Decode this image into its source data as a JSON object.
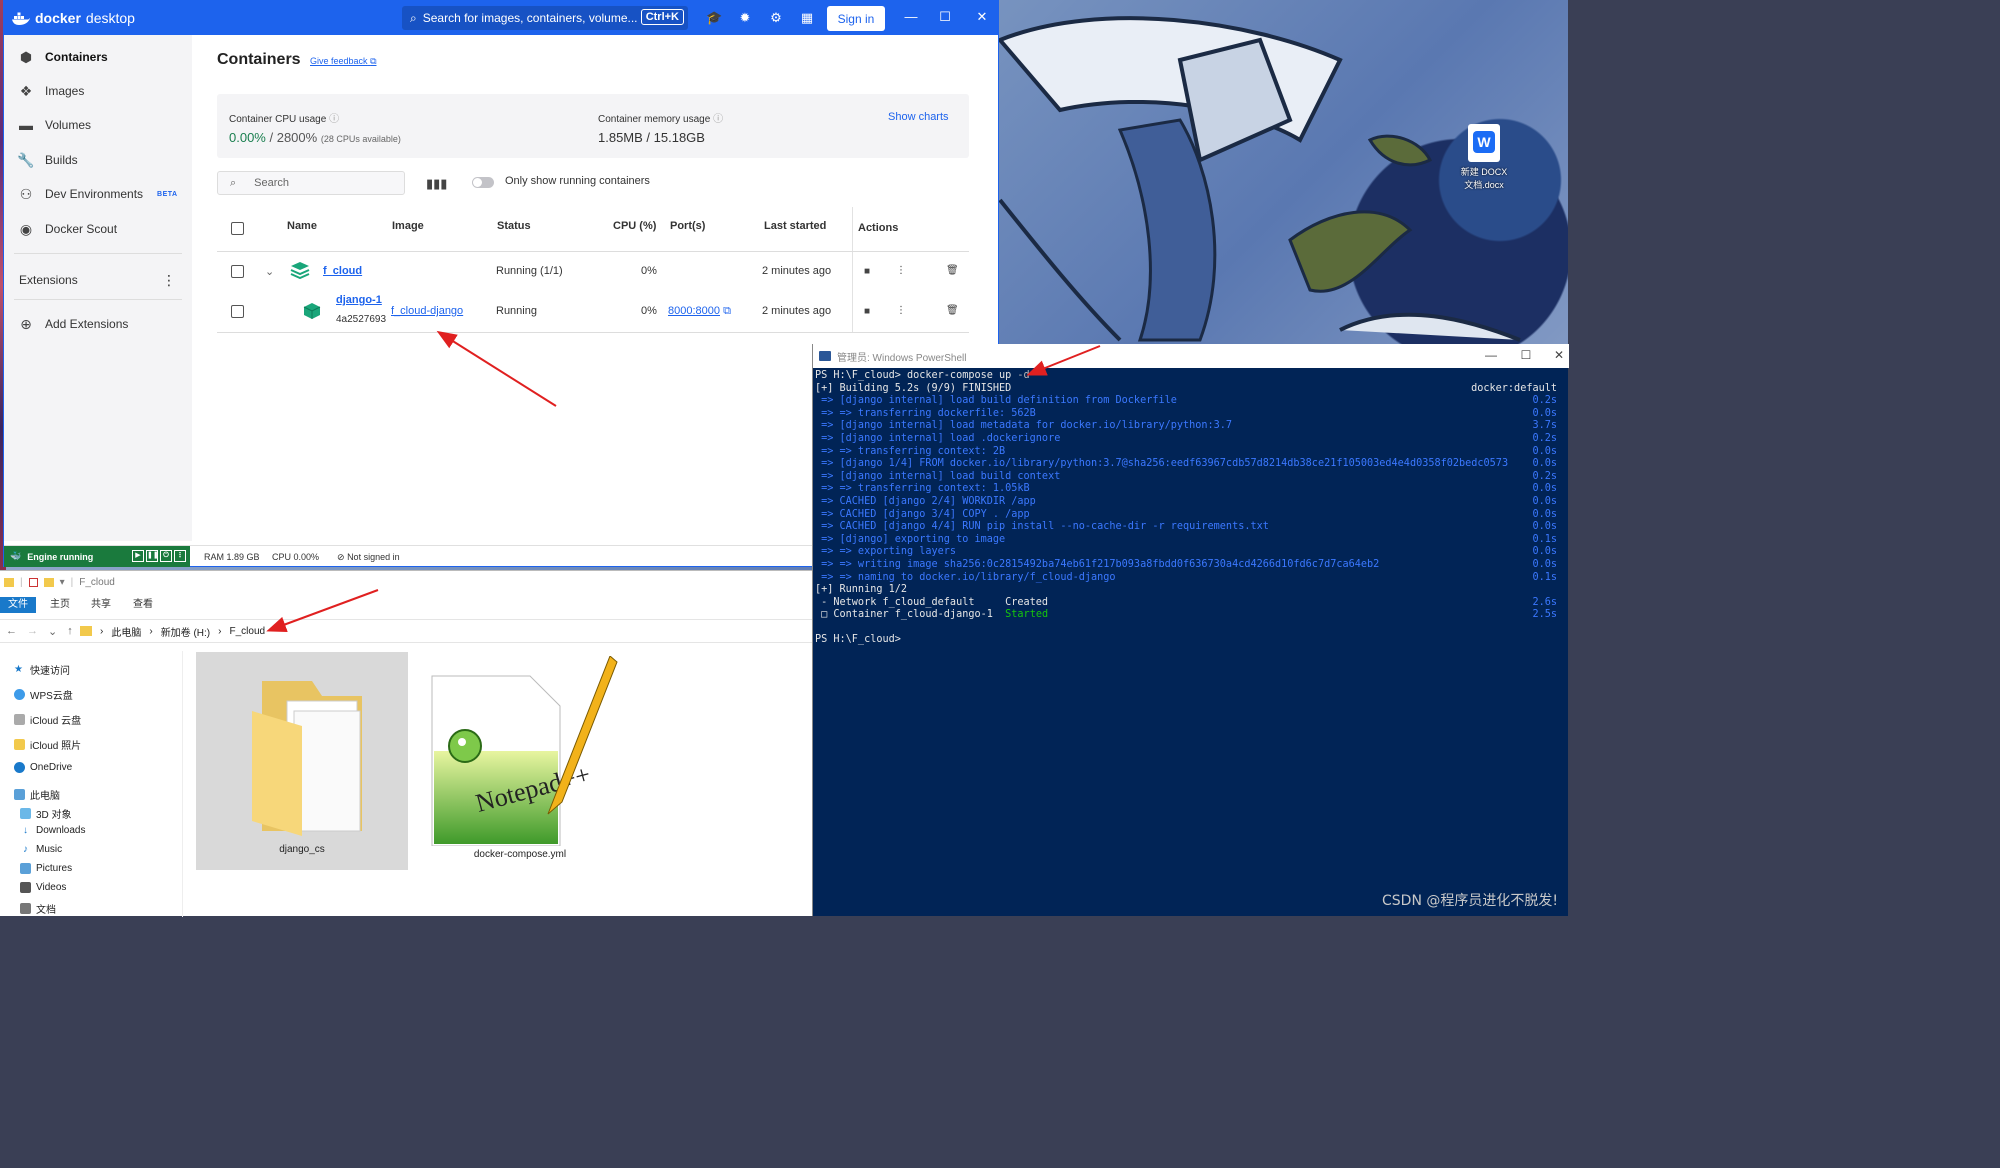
{
  "docker": {
    "app_name_bold": "docker",
    "app_name_rest": "desktop",
    "search_placeholder": "Search for images, containers, volume...",
    "search_shortcut": "Ctrl+K",
    "sign_in": "Sign in",
    "sidebar": {
      "items": [
        {
          "label": "Containers",
          "icon": "container-icon"
        },
        {
          "label": "Images",
          "icon": "images-icon"
        },
        {
          "label": "Volumes",
          "icon": "volumes-icon"
        },
        {
          "label": "Builds",
          "icon": "builds-icon"
        },
        {
          "label": "Dev Environments",
          "icon": "dev-env-icon",
          "badge": "BETA"
        },
        {
          "label": "Docker Scout",
          "icon": "scout-icon"
        }
      ],
      "extensions_label": "Extensions",
      "add_extensions": "Add Extensions"
    },
    "main": {
      "title": "Containers",
      "feedback": "Give feedback",
      "cpu_label": "Container CPU usage",
      "cpu_value": "0.00%",
      "cpu_value_rest": " / 2800%",
      "cpu_sub": "(28 CPUs available)",
      "mem_label": "Container memory usage",
      "mem_value": "1.85MB / 15.18GB",
      "show_charts": "Show charts",
      "search_placeholder": "Search",
      "toggle_label": "Only show running containers",
      "columns": [
        "Name",
        "Image",
        "Status",
        "CPU (%)",
        "Port(s)",
        "Last started",
        "Actions"
      ],
      "rows": [
        {
          "name": "f_cloud",
          "image": "",
          "status": "Running (1/1)",
          "cpu": "0%",
          "port": "",
          "last_started": "2 minutes ago"
        },
        {
          "name": "django-1",
          "id": "4a2527693",
          "image": "f_cloud-django",
          "status": "Running",
          "cpu": "0%",
          "port": "8000:8000",
          "last_started": "2 minutes ago"
        }
      ]
    },
    "status": {
      "engine": "Engine running",
      "ram": "RAM 1.89 GB",
      "cpu": "CPU 0.00%",
      "signed": "Not signed in"
    },
    "colors": {
      "brand": "#1d63ed",
      "running": "#1a7a3d"
    }
  },
  "explorer": {
    "title": "F_cloud",
    "tabs": [
      "文件",
      "主页",
      "共享",
      "查看"
    ],
    "path": [
      "此电脑",
      "新加卷 (H:)",
      "F_cloud"
    ],
    "tree": [
      "快速访问",
      "WPS云盘",
      "iCloud 云盘",
      "iCloud 照片",
      "OneDrive",
      "此电脑",
      "3D 对象",
      "Downloads",
      "Music",
      "Pictures",
      "Videos",
      "文档"
    ],
    "files": [
      {
        "name": "django_cs",
        "type": "folder"
      },
      {
        "name": "docker-compose.yml",
        "type": "notepad++-file"
      }
    ]
  },
  "powershell": {
    "title": "管理员: Windows PowerShell",
    "lines": [
      {
        "text": "PS H:\\F_cloud> docker-compose up ",
        "extra": "-d",
        "style": "plain",
        "right": ""
      },
      {
        "text": "[+] Building 5.2s (9/9) FINISHED",
        "style": "plain",
        "right": "docker:default"
      },
      {
        "text": " => [django internal] load build definition from Dockerfile",
        "style": "blue",
        "right": "0.2s"
      },
      {
        "text": " => => transferring dockerfile: 562B",
        "style": "blue",
        "right": "0.0s"
      },
      {
        "text": " => [django internal] load metadata for docker.io/library/python:3.7",
        "style": "blue",
        "right": "3.7s"
      },
      {
        "text": " => [django internal] load .dockerignore",
        "style": "blue",
        "right": "0.2s"
      },
      {
        "text": " => => transferring context: 2B",
        "style": "blue",
        "right": "0.0s"
      },
      {
        "text": " => [django 1/4] FROM docker.io/library/python:3.7@sha256:eedf63967cdb57d8214db38ce21f105003ed4e4d0358f02bedc0573",
        "style": "blue",
        "right": "0.0s"
      },
      {
        "text": " => [django internal] load build context",
        "style": "blue",
        "right": "0.2s"
      },
      {
        "text": " => => transferring context: 1.05kB",
        "style": "blue",
        "right": "0.0s"
      },
      {
        "text": " => CACHED [django 2/4] WORKDIR /app",
        "style": "blue",
        "right": "0.0s"
      },
      {
        "text": " => CACHED [django 3/4] COPY . /app",
        "style": "blue",
        "right": "0.0s"
      },
      {
        "text": " => CACHED [django 4/4] RUN pip install --no-cache-dir -r requirements.txt",
        "style": "blue",
        "right": "0.0s"
      },
      {
        "text": " => [django] exporting to image",
        "style": "blue",
        "right": "0.1s"
      },
      {
        "text": " => => exporting layers",
        "style": "blue",
        "right": "0.0s"
      },
      {
        "text": " => => writing image sha256:0c2815492ba74eb61f217b093a8fbdd0f636730a4cd4266d10fd6c7d7ca64eb2",
        "style": "blue",
        "right": "0.0s"
      },
      {
        "text": " => => naming to docker.io/library/f_cloud-django",
        "style": "blue",
        "right": "0.1s"
      },
      {
        "text": "[+] Running 1/2",
        "style": "plain",
        "right": ""
      },
      {
        "text": " - Network f_cloud_default     Created",
        "style": "plain",
        "right": "2.6s"
      },
      {
        "text": " ",
        "extra": "Container f_cloud-django-1  ",
        "tail": "Started",
        "style": "container",
        "right": "2.5s"
      },
      {
        "text": "",
        "style": "plain",
        "right": ""
      },
      {
        "text": "PS H:\\F_cloud>",
        "style": "plain",
        "right": ""
      }
    ],
    "colors": {
      "bg": "#012456",
      "accent": "#3b78ff",
      "ok": "#16c60c"
    }
  },
  "desktop": {
    "icon_label_1": "新建 DOCX",
    "icon_label_2": "文档.docx"
  },
  "watermark": "CSDN @程序员进化不脱发!"
}
